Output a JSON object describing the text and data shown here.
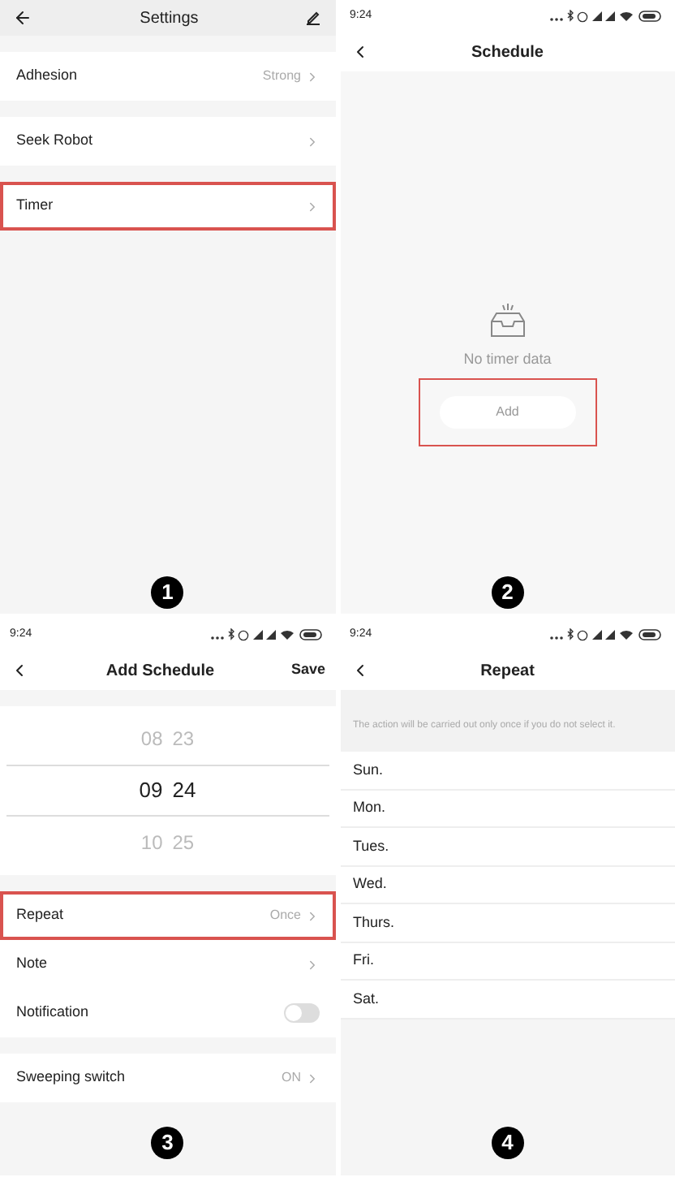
{
  "panels": [
    {
      "kind": "settings",
      "title": "Settings",
      "badge": "1",
      "groups": [
        [
          {
            "kind": "link",
            "label": "Adhesion",
            "value": "Strong",
            "highlighted": false
          }
        ],
        [
          {
            "kind": "link",
            "label": "Seek Robot",
            "highlighted": false
          }
        ],
        [
          {
            "kind": "link",
            "label": "Timer",
            "highlighted": true
          }
        ]
      ]
    },
    {
      "kind": "schedule",
      "time": "9:24",
      "title": "Schedule",
      "empty_text": "No timer data",
      "add_button": "Add",
      "add_highlighted": true,
      "badge": "2"
    },
    {
      "kind": "add_schedule",
      "time": "9:24",
      "title": "Add Schedule",
      "save": "Save",
      "badge": "3",
      "picker": [
        {
          "hour": "08",
          "minute": "23",
          "selected": false
        },
        {
          "hour": "09",
          "minute": "24",
          "selected": true
        },
        {
          "hour": "10",
          "minute": "25",
          "selected": false
        }
      ],
      "groups": [
        [
          {
            "kind": "link",
            "label": "Repeat",
            "value": "Once",
            "highlighted": true
          },
          {
            "kind": "link",
            "label": "Note",
            "highlighted": false
          },
          {
            "kind": "toggle",
            "label": "Notification",
            "on": false,
            "highlighted": false
          }
        ],
        [
          {
            "kind": "link",
            "label": "Sweeping switch",
            "value": "ON",
            "highlighted": false
          }
        ]
      ]
    },
    {
      "kind": "repeat",
      "time": "9:24",
      "title": "Repeat",
      "hint": "The action will be carried out only once if you do not select it.",
      "badge": "4",
      "days": [
        "Sun.",
        "Mon.",
        "Tues.",
        "Wed.",
        "Thurs.",
        "Fri.",
        "Sat."
      ]
    }
  ]
}
